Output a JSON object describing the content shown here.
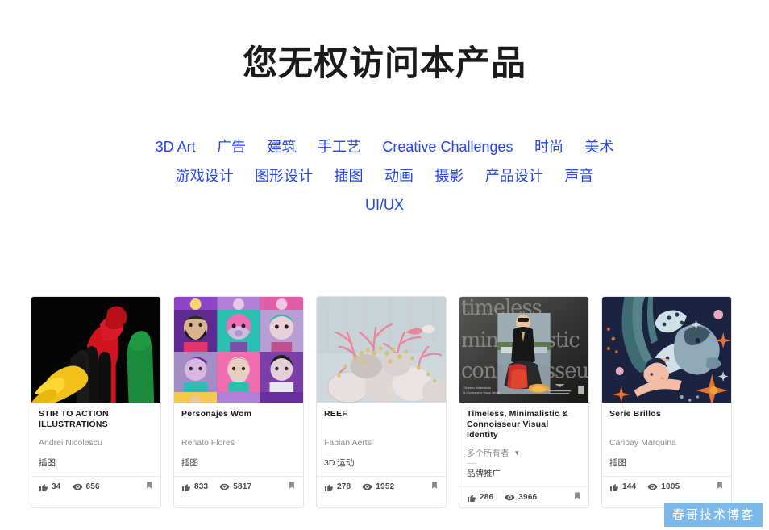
{
  "page": {
    "title": "您无权访问本产品",
    "watermark": "春哥技术博客",
    "link_color": "#2346f0"
  },
  "categories": [
    {
      "label": "3D Art"
    },
    {
      "label": "广告"
    },
    {
      "label": "建筑"
    },
    {
      "label": "手工艺"
    },
    {
      "label": "Creative Challenges"
    },
    {
      "label": "时尚"
    },
    {
      "label": "美术"
    },
    {
      "label": "游戏设计"
    },
    {
      "label": "图形设计"
    },
    {
      "label": "插图"
    },
    {
      "label": "动画"
    },
    {
      "label": "摄影"
    },
    {
      "label": "产品设计"
    },
    {
      "label": "声音"
    },
    {
      "label": "UI/UX"
    }
  ],
  "cards": [
    {
      "title": "STIR TO ACTION ILLUSTRATIONS",
      "owner": "Andrei Nicolescu",
      "multi_owner": false,
      "category": "插图",
      "likes": "34",
      "views": "656",
      "thumb_alt": "红黄绿黑手掌插画"
    },
    {
      "title": "Personajes Wom",
      "owner": "Renato Flores",
      "multi_owner": false,
      "category": "插图",
      "likes": "833",
      "views": "5817",
      "thumb_alt": "紫粉色卡通人物头像网格"
    },
    {
      "title": "REEF",
      "owner": "Fabian Aerts",
      "multi_owner": false,
      "category": "3D 运动",
      "likes": "278",
      "views": "1952",
      "thumb_alt": "粉色珊瑚与贝壳静物"
    },
    {
      "title": "Timeless, Minimalistic & Connoisseur Visual Identity",
      "owner": "多个所有者",
      "multi_owner": true,
      "category": "品牌推广",
      "likes": "286",
      "views": "3966",
      "thumb_alt": "深灰色衬线排版海报",
      "poster": {
        "word1": "timeless",
        "word2": "min",
        "word3": "con",
        "word4": "stic",
        "word5": "isseu",
        "caption_line1": "Timeless, Minimalistic",
        "caption_line2": "& Connoisseur Visual Identity",
        "logo": "D.B.A. CREATION"
      }
    },
    {
      "title": "Serie Brillos",
      "owner": "Caribay Marquina",
      "multi_owner": false,
      "category": "插图",
      "likes": "144",
      "views": "1005",
      "thumb_alt": "深蓝色夜空人物与猫插画"
    }
  ],
  "icons": {
    "like": "thumbs-up-icon",
    "view": "eye-icon",
    "bookmark": "bookmark-icon",
    "caret": "chevron-down-icon"
  }
}
